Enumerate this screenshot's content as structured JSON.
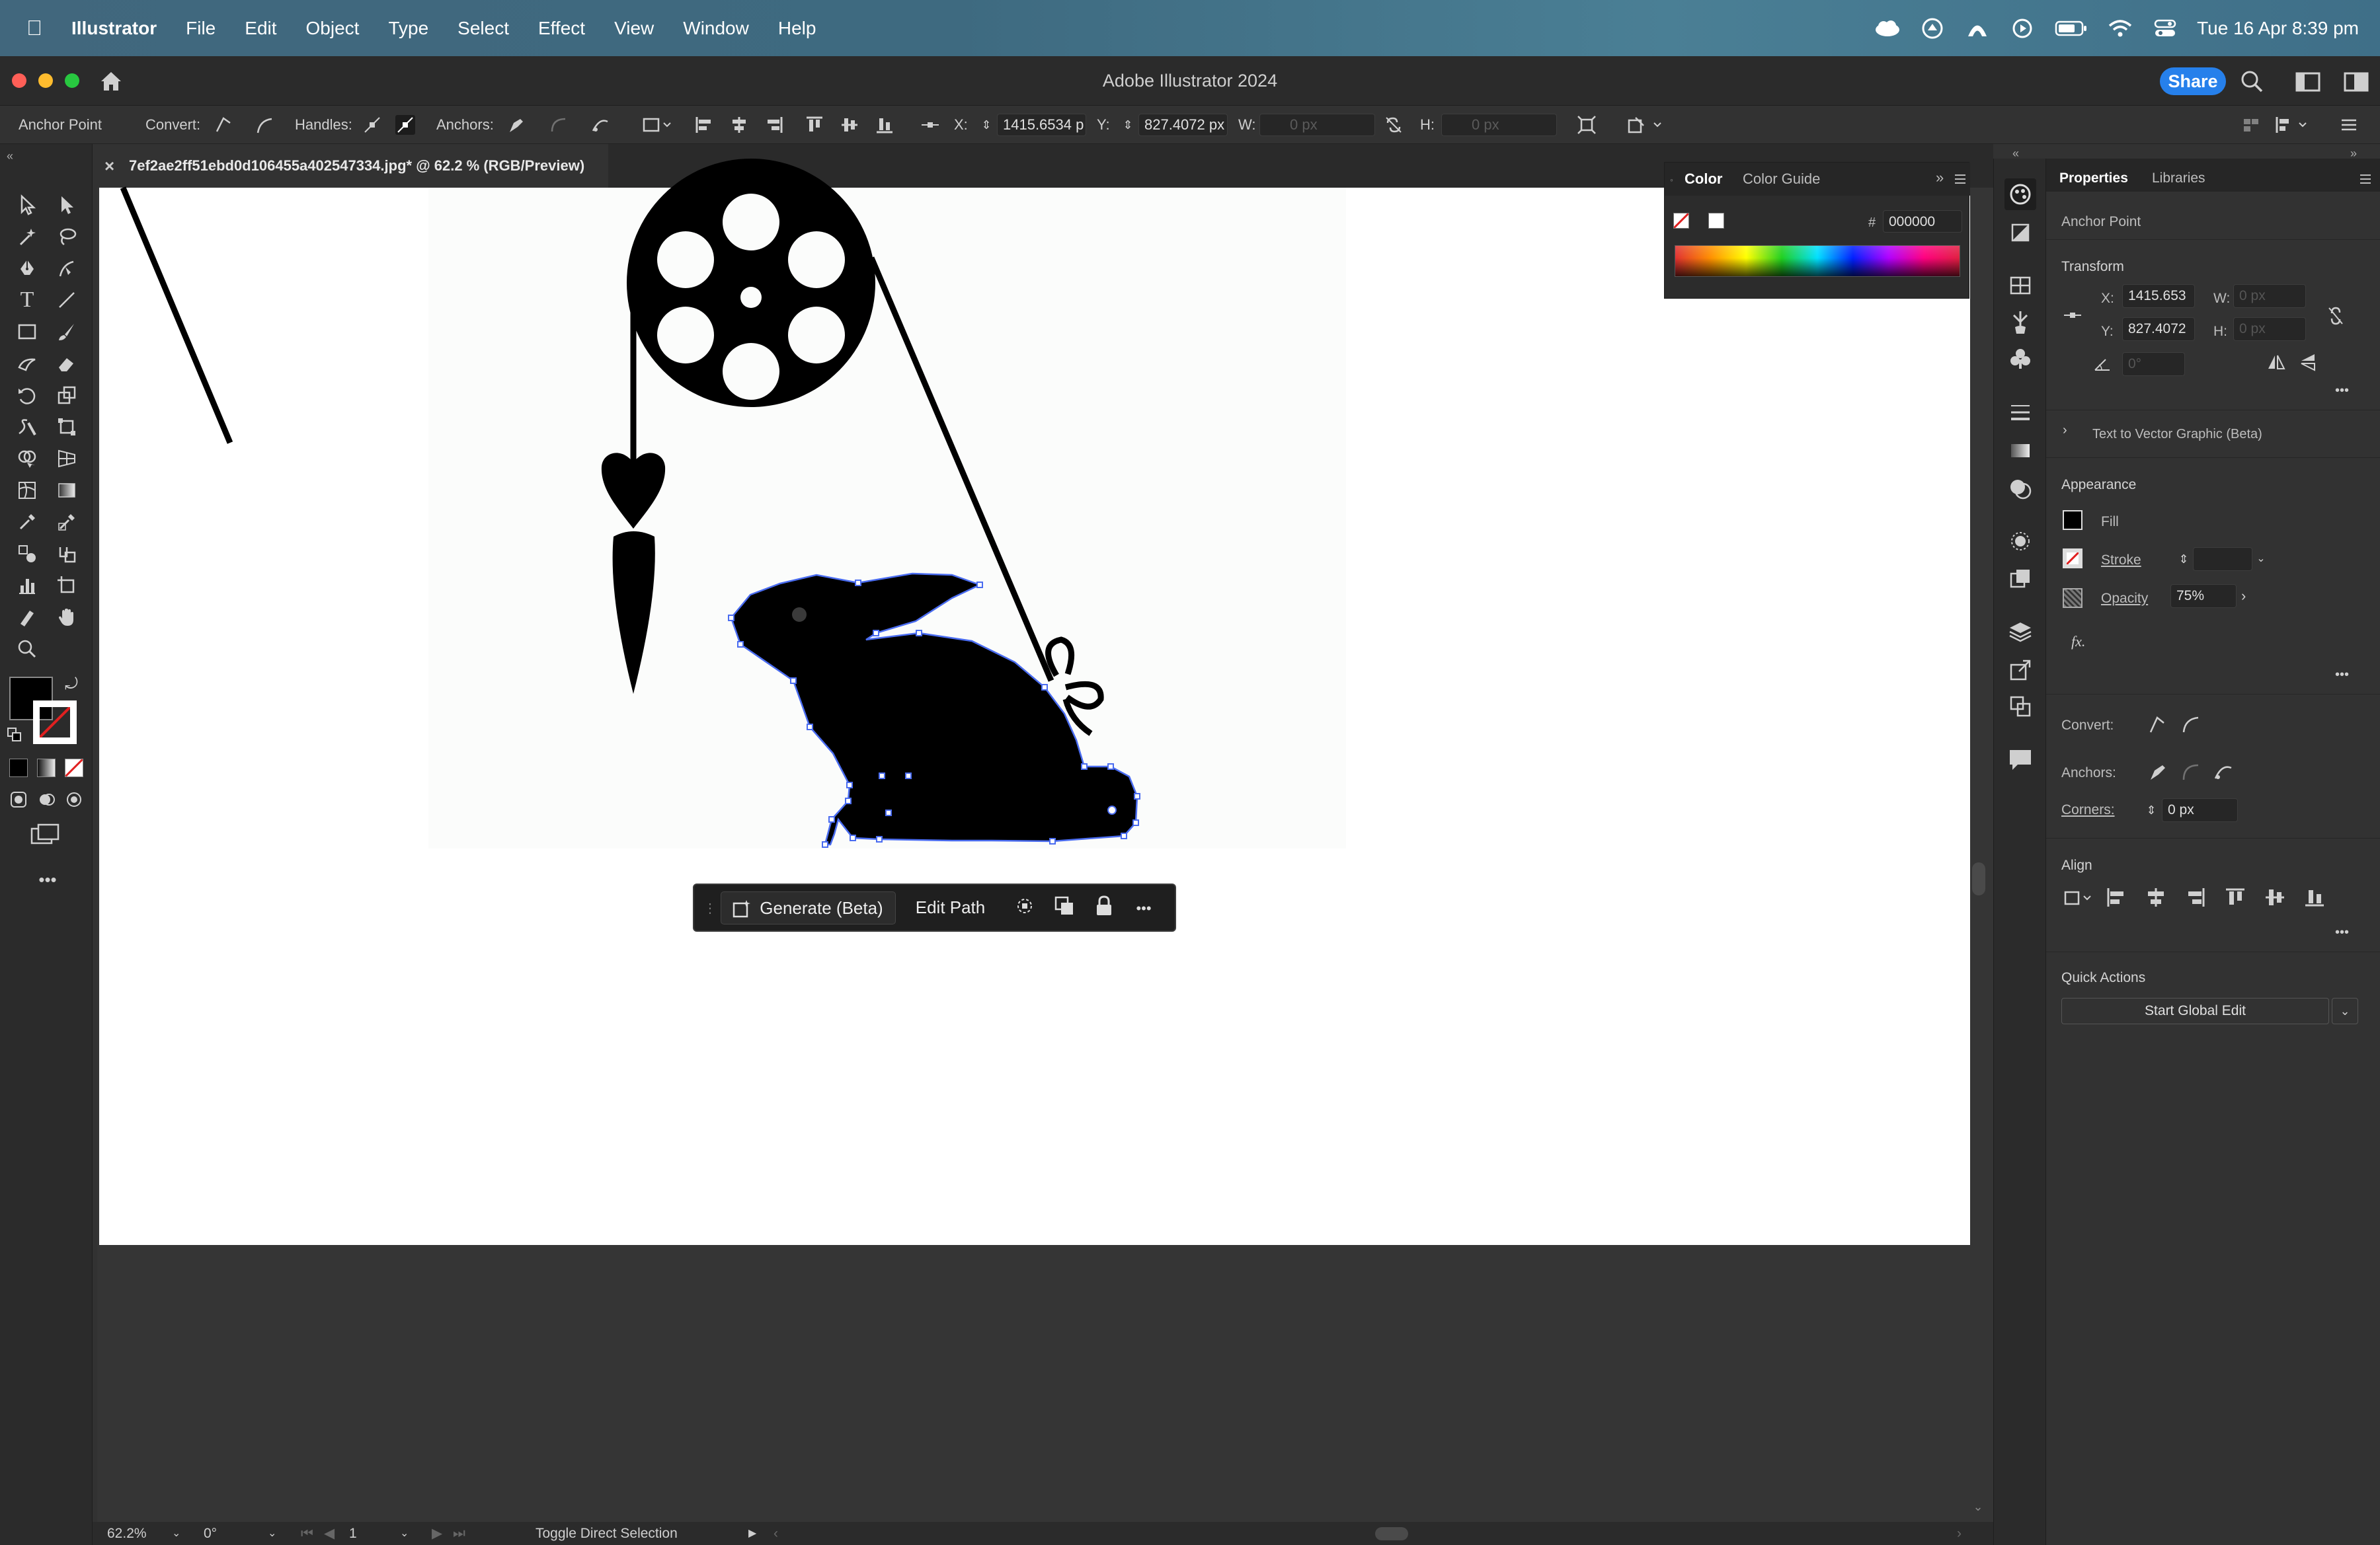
{
  "menubar": {
    "apple": "",
    "app": "Illustrator",
    "items": [
      "File",
      "Edit",
      "Object",
      "Type",
      "Select",
      "Effect",
      "View",
      "Window",
      "Help"
    ],
    "clock": "Tue 16 Apr  8:39 pm"
  },
  "titlebar": {
    "title": "Adobe Illustrator 2024",
    "share": "Share"
  },
  "controlbar": {
    "mode": "Anchor Point",
    "convert_label": "Convert:",
    "handles_label": "Handles:",
    "anchors_label": "Anchors:",
    "x_label": "X:",
    "x_value": "1415.6534 p",
    "y_label": "Y:",
    "y_value": "827.4072 px",
    "w_label": "W:",
    "w_value": "0 px",
    "h_label": "H:",
    "h_value": "0 px"
  },
  "document_tab": {
    "close": "×",
    "title": "7ef2ae2ff51ebd0d106455a402547334.jpg* @ 62.2 % (RGB/Preview)"
  },
  "context_bar": {
    "generate": "Generate (Beta)",
    "edit_path": "Edit Path",
    "more": "•••"
  },
  "color_panel": {
    "tabs": [
      "Color",
      "Color Guide"
    ],
    "hash": "#",
    "hex": "000000"
  },
  "properties": {
    "tabs": [
      "Properties",
      "Libraries"
    ],
    "selection_type": "Anchor Point",
    "transform": {
      "title": "Transform",
      "x_label": "X:",
      "x_value": "1415.653",
      "y_label": "Y:",
      "y_value": "827.4072",
      "w_label": "W:",
      "w_value": "0 px",
      "h_label": "H:",
      "h_value": "0 px",
      "angle_value": "0°"
    },
    "text_to_vector": "Text to Vector Graphic (Beta)",
    "appearance": {
      "title": "Appearance",
      "fill": "Fill",
      "stroke": "Stroke",
      "opacity": "Opacity",
      "opacity_value": "75%",
      "fx": "fx."
    },
    "convert_label": "Convert:",
    "anchors_label": "Anchors:",
    "corners_label": "Corners:",
    "corners_value": "0 px",
    "align_title": "Align",
    "quick_actions_title": "Quick Actions",
    "start_global_edit": "Start Global Edit"
  },
  "statusbar": {
    "zoom": "62.2%",
    "rotation": "0°",
    "artboard": "1",
    "status": "Toggle Direct Selection"
  },
  "colors": {
    "accent": "#2680eb",
    "selection": "#4a6cf0",
    "panel": "#323232"
  }
}
